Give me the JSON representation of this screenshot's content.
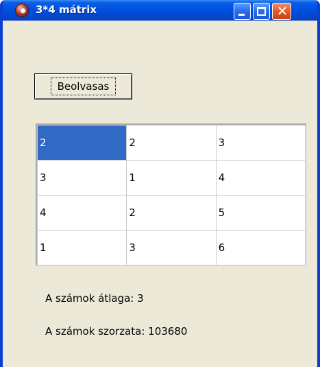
{
  "window": {
    "title": "3*4 mátrix"
  },
  "toolbar": {
    "read_button_label": "Beolvasas"
  },
  "grid": {
    "rows": [
      [
        "2",
        "2",
        "3"
      ],
      [
        "3",
        "1",
        "4"
      ],
      [
        "4",
        "2",
        "5"
      ],
      [
        "1",
        "3",
        "6"
      ]
    ],
    "selected_cell": "row 1, column 1"
  },
  "results": {
    "average_text": "A számok átlaga: 3",
    "product_text": "A számok szorzata: 103680"
  },
  "colors": {
    "titlebar": "#0054e3",
    "selection": "#316ac5",
    "window_bg": "#ece9d8",
    "close_button": "#e05a2a"
  },
  "icons": {
    "app": "app-icon",
    "minimize": "minimize-icon",
    "maximize": "maximize-icon",
    "close": "close-icon"
  }
}
